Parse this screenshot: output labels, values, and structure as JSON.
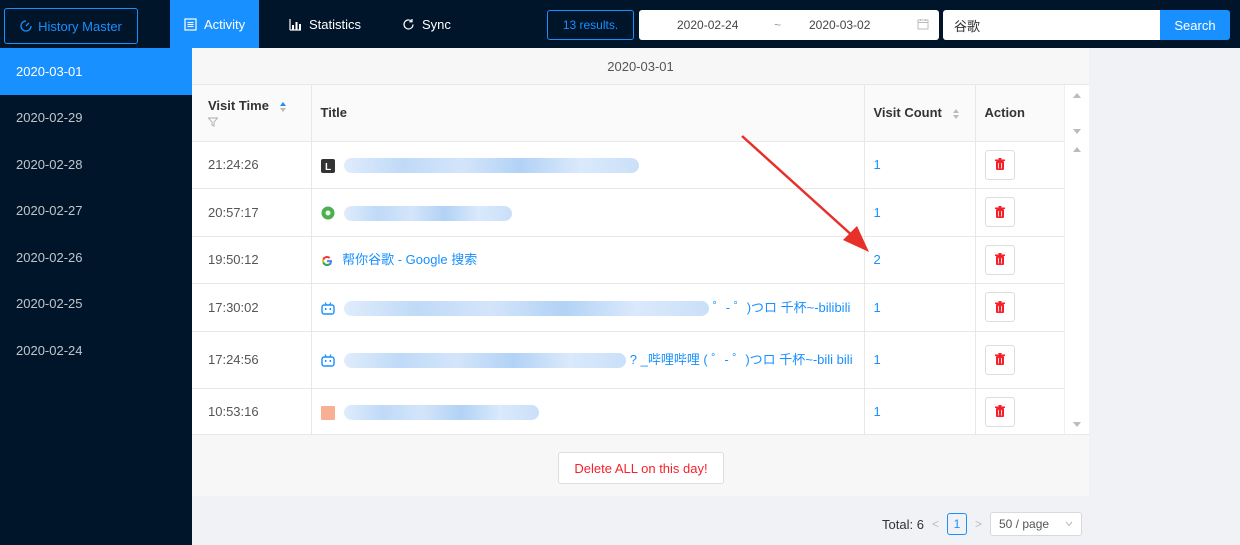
{
  "header": {
    "brand_label": "History Master",
    "tabs": [
      {
        "label": "Activity",
        "icon": "list-icon",
        "active": true
      },
      {
        "label": "Statistics",
        "icon": "bar-chart-icon",
        "active": false
      },
      {
        "label": "Sync",
        "icon": "sync-icon",
        "active": false
      }
    ],
    "results_label": "13 results.",
    "date_start": "2020-02-24",
    "date_separator": "~",
    "date_end": "2020-03-02",
    "search_value": "谷歌",
    "search_button": "Search"
  },
  "sidebar": {
    "items": [
      {
        "label": "2020-03-01",
        "active": true
      },
      {
        "label": "2020-02-29",
        "active": false
      },
      {
        "label": "2020-02-28",
        "active": false
      },
      {
        "label": "2020-02-27",
        "active": false
      },
      {
        "label": "2020-02-26",
        "active": false
      },
      {
        "label": "2020-02-25",
        "active": false
      },
      {
        "label": "2020-02-24",
        "active": false
      }
    ]
  },
  "main": {
    "day_title": "2020-03-01",
    "columns": {
      "visit_time": "Visit Time",
      "title": "Title",
      "visit_count": "Visit Count",
      "action": "Action"
    },
    "rows": [
      {
        "time": "21:24:26",
        "title": "",
        "count": "1"
      },
      {
        "time": "20:57:17",
        "title": "",
        "count": "1"
      },
      {
        "time": "19:50:12",
        "title": "帮你谷歌 - Google 搜索",
        "count": "2"
      },
      {
        "time": "17:30:02",
        "title": "゜- ゜)つロ 千杯~-bilibili",
        "count": "1"
      },
      {
        "time": "17:24:56",
        "title": "? _哔哩哔哩 ( ゜- ゜)つロ 千杯~-bili bili",
        "count": "1"
      },
      {
        "time": "10:53:16",
        "title": "",
        "count": "1"
      }
    ],
    "delete_all_label": "Delete ALL on this day!",
    "pagination": {
      "total_label": "Total: 6",
      "current_page": "1",
      "page_size": "50 / page"
    }
  },
  "colors": {
    "accent": "#1890ff",
    "nav_bg": "#001529",
    "danger": "#f5222d",
    "annotation": "#e8302a"
  }
}
